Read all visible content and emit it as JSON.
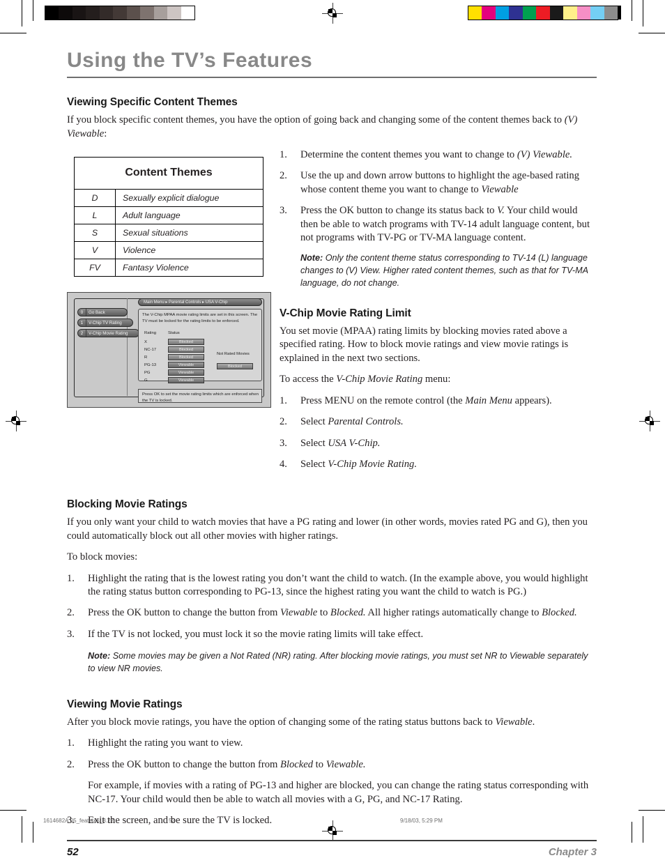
{
  "document": {
    "page_title": "Using the TV’s Features",
    "page_number": "52",
    "chapter_label": "Chapter 3"
  },
  "print_marks": {
    "slug_filename": "1614682A.05_features_8.22",
    "slug_page": "52",
    "slug_timestamp": "9/18/03, 5:29 PM",
    "grayscale_wedge": [
      "#000000",
      "#0d0a0a",
      "#191414",
      "#241e1d",
      "#332b29",
      "#433936",
      "#5b504c",
      "#7e736f",
      "#a79f9c",
      "#cdc5c3",
      "#ffffff"
    ],
    "color_bars": [
      "#ffe000",
      "#e5007e",
      "#009fe3",
      "#2e3192",
      "#00a050",
      "#ed1c24",
      "#1a1a1a",
      "#fff08a",
      "#f68fc6",
      "#74cff4",
      "#8c8c8c"
    ]
  },
  "sections": {
    "content_themes": {
      "heading": "Viewing Specific Content Themes",
      "intro_a": "If you block specific content themes, you have the option of going back and changing some of the content themes back to ",
      "intro_b": "(V) Viewable",
      "intro_c": ":",
      "steps": [
        {
          "num": "1.",
          "parts": [
            {
              "t": "Determine the content themes you want to change to ",
              "i": false
            },
            {
              "t": "(V) Viewable.",
              "i": true
            }
          ]
        },
        {
          "num": "2.",
          "parts": [
            {
              "t": "Use the up and down arrow buttons to highlight the age-based rating whose content theme you want to change to ",
              "i": false
            },
            {
              "t": "Viewable",
              "i": true
            }
          ]
        },
        {
          "num": "3.",
          "parts": [
            {
              "t": "Press the OK button to change its status back to ",
              "i": false
            },
            {
              "t": "V.",
              "i": true
            },
            {
              "t": "  Your child would then be able to watch programs with TV-14 adult language content, but not programs with TV-PG or TV-MA language content.",
              "i": false
            }
          ]
        }
      ],
      "note_label": "Note:",
      "note_text": "Only the content theme status corresponding to TV-14 (L) language changes to (V) View. Higher rated content themes, such as that for TV-MA language, do not change."
    },
    "themes_table": {
      "caption": "Content Themes",
      "rows": [
        {
          "code": "D",
          "desc": "Sexually explicit dialogue"
        },
        {
          "code": "L",
          "desc": "Adult language"
        },
        {
          "code": "S",
          "desc": "Sexual situations"
        },
        {
          "code": "V",
          "desc": "Violence"
        },
        {
          "code": "FV",
          "desc": "Fantasy Violence"
        }
      ]
    },
    "tv_screen": {
      "breadcrumb": "Main Menu ▸ Parental Controls ▸ USA V-Chip",
      "menu_buttons": [
        {
          "num": "0",
          "label": "Go Back"
        },
        {
          "num": "1",
          "label": "V-Chip TV Rating"
        },
        {
          "num": "2",
          "label": "V-Chip Movie Rating"
        }
      ],
      "description": "The V-Chip MPAA movie rating limits are set in this screen. The TV must be locked for the rating limits to be enforced.",
      "col_rating": "Rating",
      "col_status": "Status",
      "ratings": [
        {
          "rating": "X",
          "status": "Blocked"
        },
        {
          "rating": "NC-17",
          "status": "Blocked"
        },
        {
          "rating": "R",
          "status": "Blocked"
        },
        {
          "rating": "PG-13",
          "status": "Viewable"
        },
        {
          "rating": "PG",
          "status": "Viewable"
        },
        {
          "rating": "G",
          "status": "Viewable"
        }
      ],
      "not_rated_label": "Not Rated Movies",
      "not_rated_status": "Blocked",
      "footer_text": "Press OK to set the movie rating limits which are enforced when the TV is locked."
    },
    "movie_rating_limit": {
      "heading": "V-Chip Movie Rating Limit",
      "para": "You set movie (MPAA) rating limits by blocking movies rated above a specified rating. How to block movie ratings and view movie ratings is explained in the next two sections.",
      "access_a": "To access the ",
      "access_b": "V-Chip Movie Rating",
      "access_c": " menu:",
      "steps": [
        {
          "num": "1.",
          "parts": [
            {
              "t": "Press MENU on the remote control (the ",
              "i": false
            },
            {
              "t": "Main Menu",
              "i": true
            },
            {
              "t": " appears).",
              "i": false
            }
          ]
        },
        {
          "num": "2.",
          "parts": [
            {
              "t": "Select ",
              "i": false
            },
            {
              "t": "Parental Controls.",
              "i": true
            }
          ]
        },
        {
          "num": "3.",
          "parts": [
            {
              "t": "Select ",
              "i": false
            },
            {
              "t": "USA V-Chip.",
              "i": true
            }
          ]
        },
        {
          "num": "4.",
          "parts": [
            {
              "t": "Select ",
              "i": false
            },
            {
              "t": "V-Chip Movie Rating.",
              "i": true
            }
          ]
        }
      ]
    },
    "blocking": {
      "heading": "Blocking Movie Ratings",
      "para1": "If you only want your child to watch movies that have a PG rating and lower (in other words, movies rated PG and G), then you could automatically block out all other movies with higher ratings.",
      "para2": "To block movies:",
      "steps": [
        {
          "num": "1.",
          "parts": [
            {
              "t": "Highlight the rating that is the lowest rating you don’t want the child to watch. (In the example above, you would highlight the rating status button corresponding to PG-13, since the highest rating you want the child to watch is PG.)",
              "i": false
            }
          ]
        },
        {
          "num": "2.",
          "parts": [
            {
              "t": "Press the OK button to change the button from ",
              "i": false
            },
            {
              "t": "Viewable",
              "i": true
            },
            {
              "t": " to ",
              "i": false
            },
            {
              "t": "Blocked.",
              "i": true
            },
            {
              "t": " All higher ratings automatically change to ",
              "i": false
            },
            {
              "t": "Blocked.",
              "i": true
            }
          ]
        },
        {
          "num": "3.",
          "parts": [
            {
              "t": "If the TV is not locked, you must lock it so the movie rating limits will take effect.",
              "i": false
            }
          ]
        }
      ],
      "note_label": "Note:",
      "note_text": "Some movies may be given a Not Rated (NR) rating. After blocking movie ratings, you must set NR to Viewable separately to view NR movies."
    },
    "viewing": {
      "heading": "Viewing Movie Ratings",
      "para_a": "After you block movie ratings, you have the option of changing some of the rating status buttons back to ",
      "para_b": "Viewable",
      "para_c": ".",
      "steps": [
        {
          "num": "1.",
          "parts": [
            {
              "t": "Highlight the rating you want to view.",
              "i": false
            }
          ]
        },
        {
          "num": "2.",
          "parts": [
            {
              "t": "Press the OK button to change the button from ",
              "i": false
            },
            {
              "t": "Blocked",
              "i": true
            },
            {
              "t": "  to ",
              "i": false
            },
            {
              "t": "Viewable.",
              "i": true
            }
          ]
        },
        {
          "num": "",
          "sub": true,
          "parts": [
            {
              "t": "For example, if movies with a rating of PG-13 and higher are blocked, you can change the rating status corresponding with NC-17. Your child would then be able to watch all movies with a G, PG, and NC-17 Rating.",
              "i": false
            }
          ]
        },
        {
          "num": "3.",
          "parts": [
            {
              "t": "Exit the screen, and be sure the TV is locked.",
              "i": false
            }
          ]
        }
      ]
    }
  }
}
